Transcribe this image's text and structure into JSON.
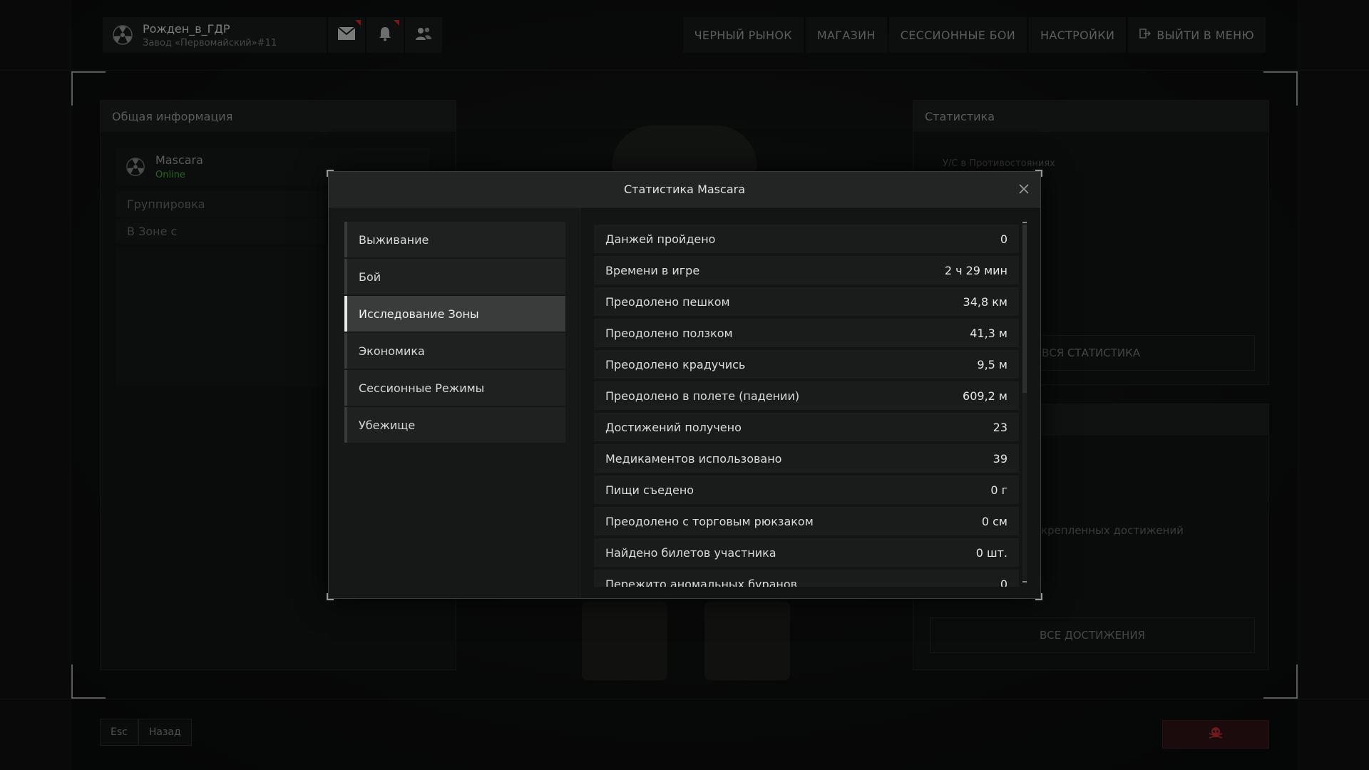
{
  "header": {
    "player_nick": "Рожден_в_ГДР",
    "location": "Завод «Первомайский»#11",
    "icons": [
      "radiation-icon",
      "mail-icon",
      "bell-icon",
      "friends-icon"
    ]
  },
  "nav": {
    "black_market": "ЧЕРНЫЙ РЫНОК",
    "shop": "МАГАЗИН",
    "session_battles": "СЕССИОННЫЕ БОИ",
    "settings": "НАСТРОЙКИ",
    "exit": "ВЫЙТИ В МЕНЮ"
  },
  "left_panel": {
    "title": "Общая информация",
    "player_name": "Mascara",
    "status": "Online",
    "group_label": "Группировка",
    "zone_label": "В Зоне с"
  },
  "right_panel": {
    "title": "Статистика",
    "kd_label": "У/С в Противостояниях",
    "all_stats": "ВСЯ СТАТИСТИКА",
    "pinned_text": "крепленных достижений",
    "all_achievements": "ВСЕ ДОСТИЖЕНИЯ"
  },
  "bottom": {
    "esc": "Esc",
    "back": "Назад"
  },
  "modal": {
    "title": "Статистика Mascara",
    "categories": [
      {
        "label": "Выживание",
        "active": false
      },
      {
        "label": "Бой",
        "active": false
      },
      {
        "label": "Исследование Зоны",
        "active": true
      },
      {
        "label": "Экономика",
        "active": false
      },
      {
        "label": "Сессионные Режимы",
        "active": false
      },
      {
        "label": "Убежище",
        "active": false
      }
    ],
    "stats": [
      {
        "label": "Данжей пройдено",
        "value": "0"
      },
      {
        "label": "Времени в игре",
        "value": "2 ч 29 мин"
      },
      {
        "label": "Преодолено пешком",
        "value": "34,8 км"
      },
      {
        "label": "Преодолено ползком",
        "value": "41,3 м"
      },
      {
        "label": "Преодолено крадучись",
        "value": "9,5 м"
      },
      {
        "label": "Преодолено в полете (падении)",
        "value": "609,2 м"
      },
      {
        "label": "Достижений получено",
        "value": "23"
      },
      {
        "label": "Медикаментов использовано",
        "value": "39"
      },
      {
        "label": "Пищи съедено",
        "value": "0 г"
      },
      {
        "label": "Преодолено с торговым рюкзаком",
        "value": "0 см"
      },
      {
        "label": "Найдено билетов участника",
        "value": "0 шт."
      },
      {
        "label": "Пережито аномальных буранов",
        "value": "0"
      }
    ]
  },
  "colors": {
    "accent_active": "#3a3c3c",
    "online": "#3d9a3a",
    "notification": "#b3262a"
  }
}
